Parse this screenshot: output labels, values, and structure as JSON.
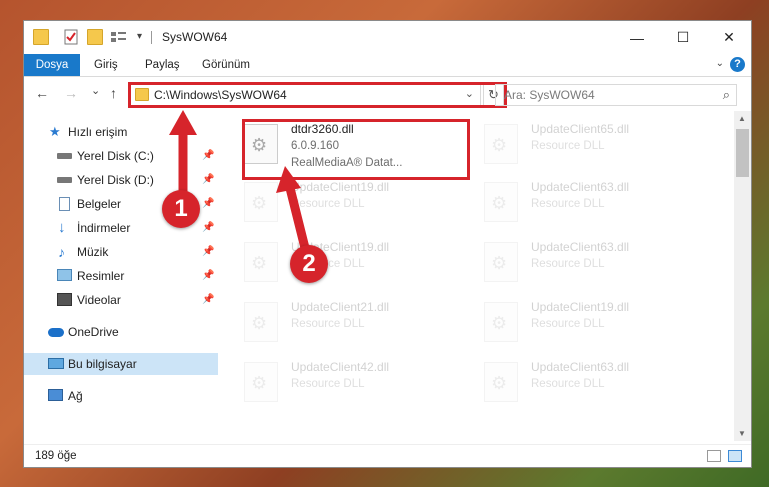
{
  "window": {
    "title": "SysWOW64",
    "controls": {
      "minimize": "—",
      "maximize": "☐",
      "close": "✕"
    }
  },
  "ribbon": {
    "tabs": [
      "Dosya",
      "Giriş",
      "Paylaş",
      "Görünüm"
    ],
    "help": "?"
  },
  "nav": {
    "back": "←",
    "forward": "→",
    "recent": "⌄",
    "up": "↑",
    "address": "C:\\Windows\\SysWOW64",
    "address_dropdown": "⌄",
    "refresh": "↻",
    "search_placeholder": "Ara: SysWOW64"
  },
  "sidebar": {
    "items": [
      {
        "label": "Hızlı erişim",
        "icon": "star-icon",
        "pinned": false
      },
      {
        "label": "Yerel Disk (C:)",
        "icon": "drive-icon",
        "pinned": true
      },
      {
        "label": "Yerel Disk (D:)",
        "icon": "drive-icon",
        "pinned": true
      },
      {
        "label": "Belgeler",
        "icon": "document-icon",
        "pinned": true
      },
      {
        "label": "İndirmeler",
        "icon": "download-icon",
        "pinned": true
      },
      {
        "label": "Müzik",
        "icon": "music-icon",
        "pinned": true
      },
      {
        "label": "Resimler",
        "icon": "picture-icon",
        "pinned": true
      },
      {
        "label": "Videolar",
        "icon": "video-icon",
        "pinned": true
      },
      {
        "label": "OneDrive",
        "icon": "cloud-icon",
        "pinned": false
      },
      {
        "label": "Bu bilgisayar",
        "icon": "computer-icon",
        "pinned": false,
        "selected": true
      },
      {
        "label": "Ağ",
        "icon": "network-icon",
        "pinned": false
      }
    ]
  },
  "files": {
    "highlighted": {
      "name": "dtdr3260.dll",
      "version": "6.0.9.160",
      "description": "RealMediaA® Datat..."
    },
    "left_column": [
      {
        "name": "UpdateClient19.dll",
        "desc": "Resource DLL"
      },
      {
        "name": "UpdateClient19.dll",
        "desc": "Resource DLL"
      },
      {
        "name": "UpdateClient21.dll",
        "desc": "Resource DLL"
      },
      {
        "name": "UpdateClient42.dll",
        "desc": "Resource DLL"
      }
    ],
    "right_column": [
      {
        "name": "UpdateClient65.dll",
        "desc": "Resource DLL"
      },
      {
        "name": "UpdateClient63.dll",
        "desc": "Resource DLL"
      },
      {
        "name": "UpdateClient63.dll",
        "desc": "Resource DLL"
      },
      {
        "name": "UpdateClient19.dll",
        "desc": "Resource DLL"
      },
      {
        "name": "UpdateClient63.dll",
        "desc": "Resource DLL"
      }
    ]
  },
  "status": {
    "count": "189 öğe"
  },
  "annotations": {
    "step1": "1",
    "step2": "2",
    "color": "#d6242b"
  }
}
